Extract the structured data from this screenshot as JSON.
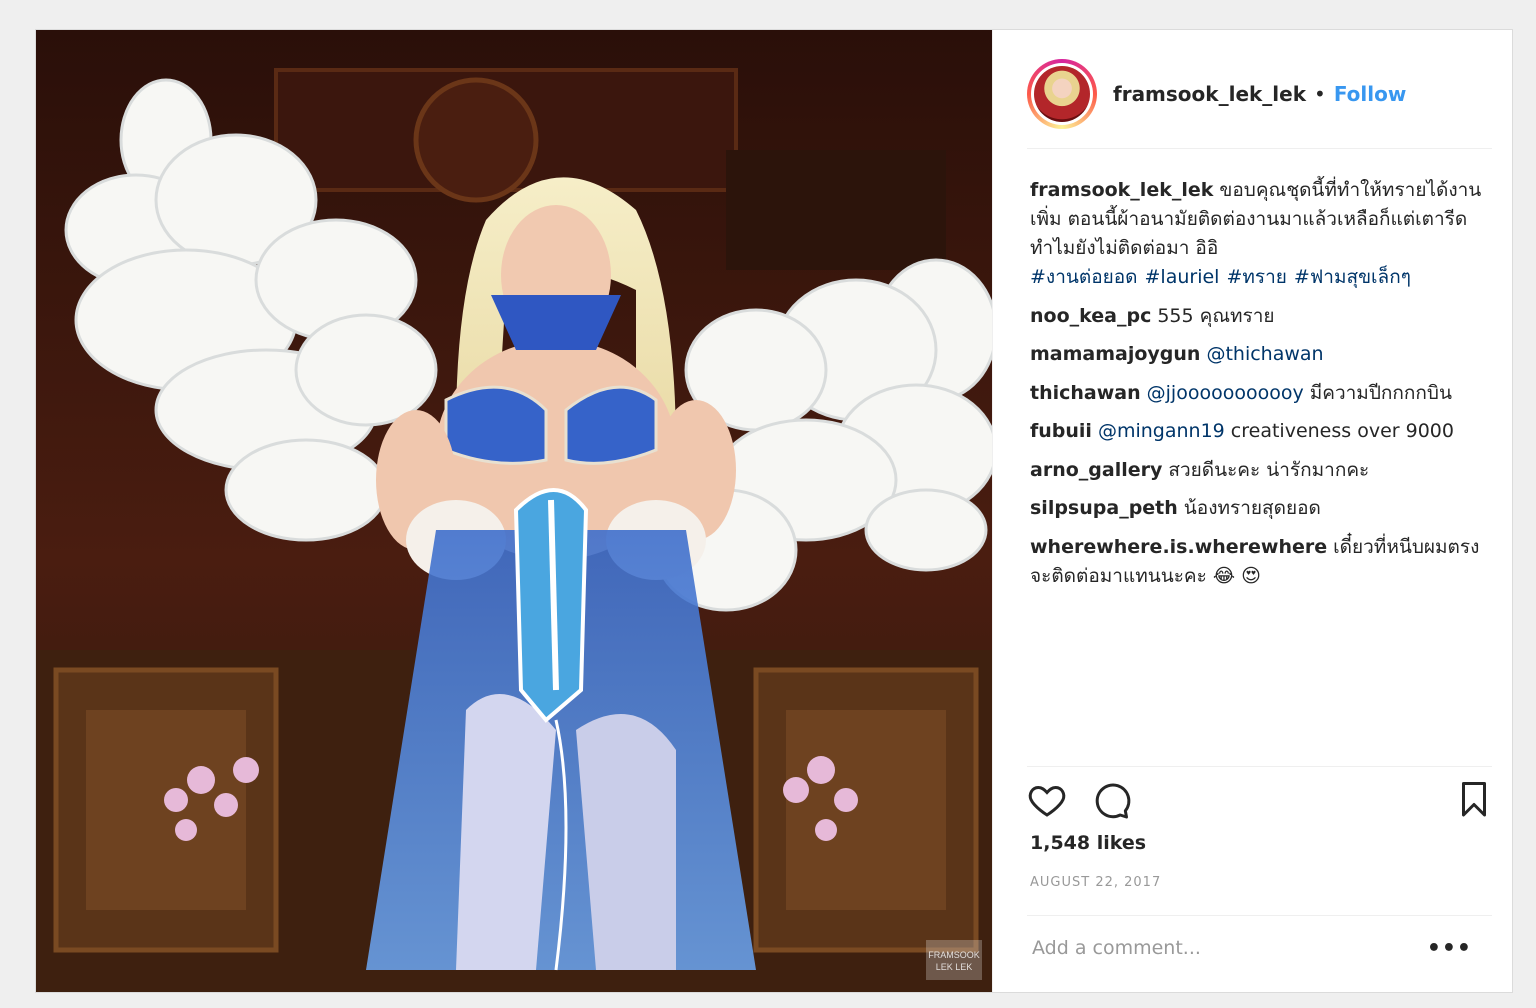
{
  "post": {
    "username": "framsook_lek_lek",
    "separator": "•",
    "follow_label": "Follow",
    "caption": {
      "user": "framsook_lek_lek",
      "text": "ขอบคุณชุดนี้ที่ทำให้ทรายได้งานเพิ่ม ตอนนี้ผ้าอนามัยติดต่องานมาแล้วเหลือก็แต่เตารีดทำไมยังไม่ติดต่อมา อิอิ",
      "hashtags": [
        "#งานต่อยอด",
        "#lauriel",
        "#ทราย",
        "#ฟามสุขเล็กๆ"
      ]
    },
    "comments": [
      {
        "user": "noo_kea_pc",
        "mention": "",
        "text": "555 คุณทราย"
      },
      {
        "user": "mamamajoygun",
        "mention": "@thichawan",
        "text": ""
      },
      {
        "user": "thichawan",
        "mention": "@jjooooooooooy",
        "text": "มีความปีกกกกบิน"
      },
      {
        "user": "fubuii",
        "mention": "@mingann19",
        "text": "creativeness over 9000"
      },
      {
        "user": "arno_gallery",
        "mention": "",
        "text": "สวยดีนะคะ น่ารักมากคะ"
      },
      {
        "user": "silpsupa_peth",
        "mention": "",
        "text": "น้องทรายสุดยอด"
      },
      {
        "user": "wherewhere.is.wherewhere",
        "mention": "",
        "text": "เดี๋ยวที่หนีบผมตรงจะติดต่อมาแทนนะคะ 😂 😍"
      }
    ],
    "likes": "1,548 likes",
    "date": "AUGUST 22, 2017",
    "add_comment_placeholder": "Add a comment...",
    "more_label": "•••",
    "watermark": "FRAMSOOK LEK LEK"
  },
  "icons": {
    "like": "heart-icon",
    "comment": "comment-bubble-icon",
    "save": "bookmark-icon",
    "more": "ellipsis-icon"
  },
  "colors": {
    "link": "#003569",
    "follow": "#3897f0",
    "muted": "#999999",
    "text": "#262626"
  }
}
